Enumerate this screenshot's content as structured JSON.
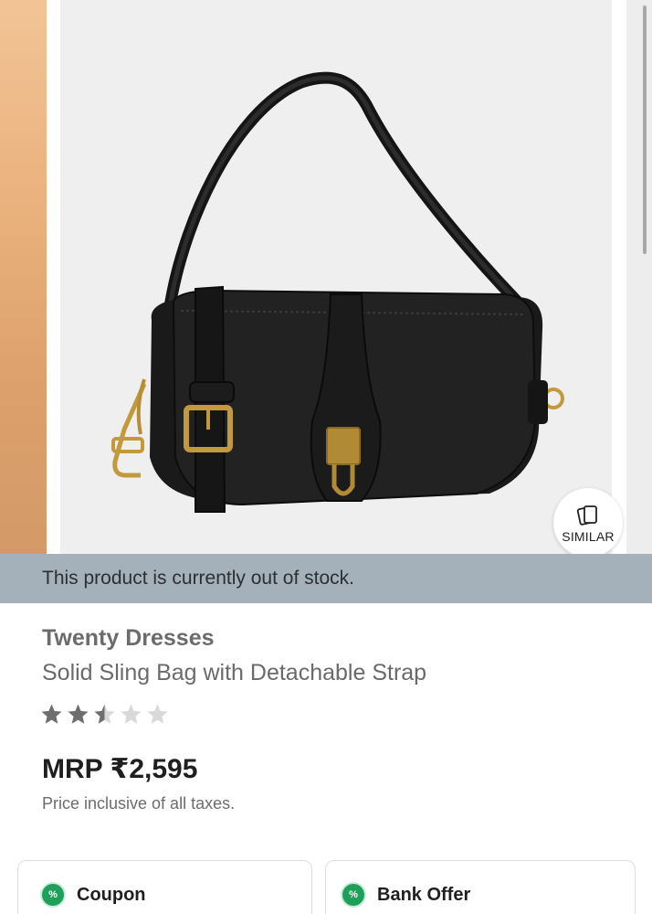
{
  "gallery": {
    "similar_label": "SIMILAR",
    "icons": {
      "similar": "stacked-cards-icon"
    }
  },
  "stock": {
    "message": "This product is currently out of stock."
  },
  "product": {
    "brand": "Twenty Dresses",
    "name": "Solid Sling Bag with Detachable Strap",
    "rating": 2.5,
    "rating_max": 5,
    "price": "MRP ₹2,595",
    "tax_note": "Price inclusive of all taxes."
  },
  "offers": [
    {
      "label": "Coupon",
      "icon": "percent-badge-icon",
      "icon_text": "%"
    },
    {
      "label": "Bank Offer",
      "icon": "percent-badge-icon",
      "icon_text": "%"
    }
  ],
  "colors": {
    "banner_bg": "#a5b1ba",
    "star_filled": "#6e6e6e",
    "star_empty": "#d9d9d9",
    "offer_icon": "#1e9f5a"
  }
}
